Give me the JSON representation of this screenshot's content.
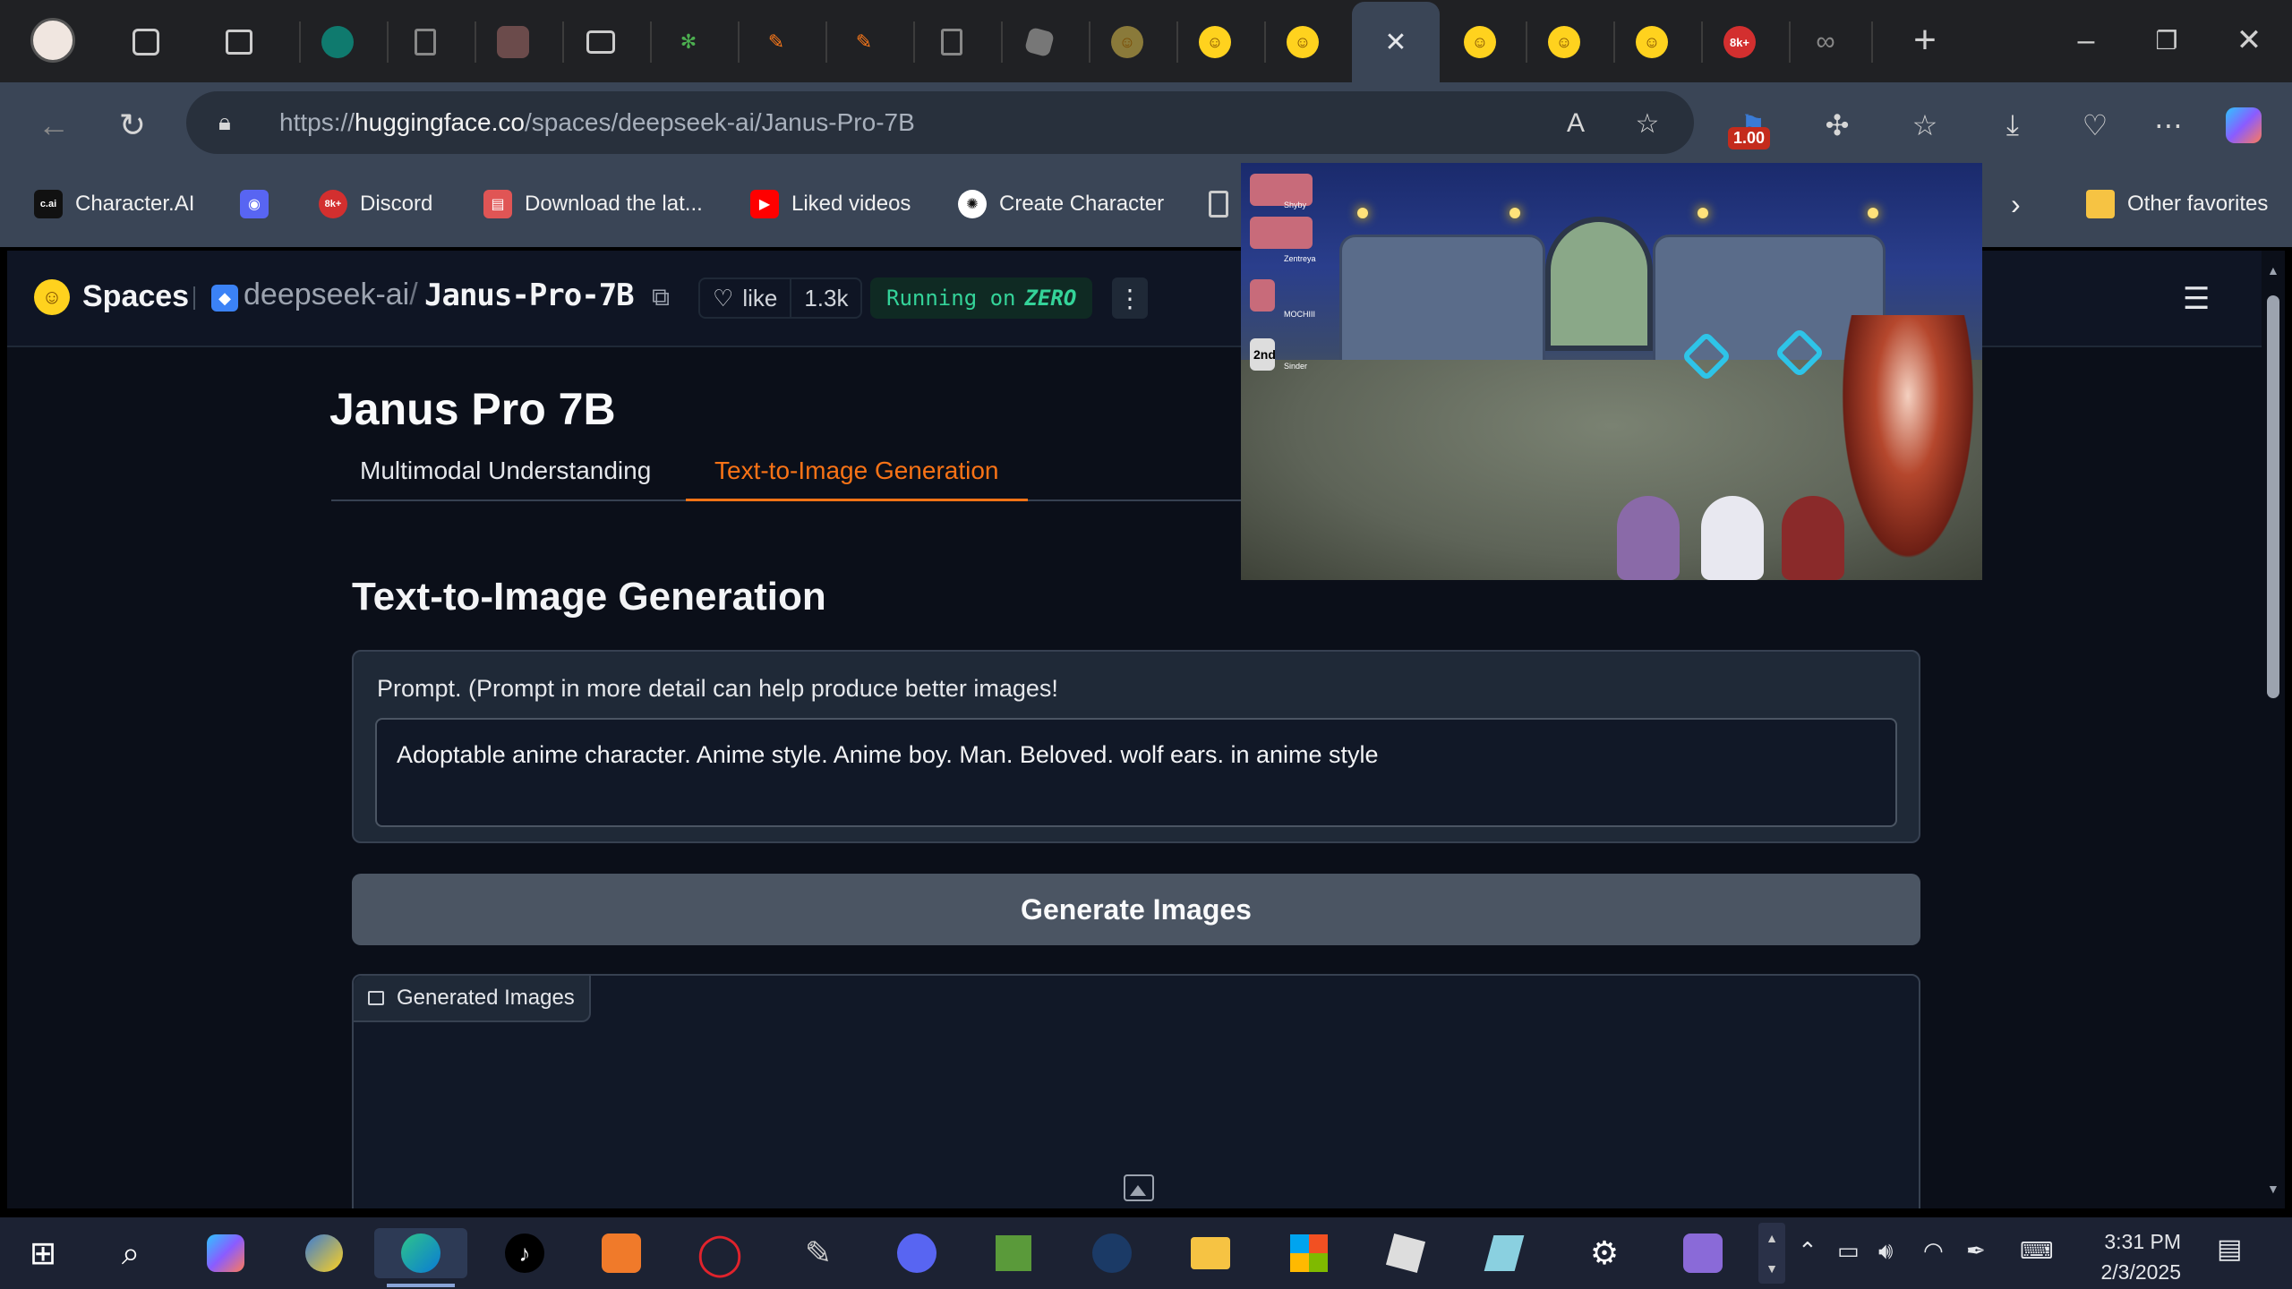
{
  "browser": {
    "url_prefix": "https://",
    "url_host": "huggingface.co",
    "url_path": "/spaces/deepseek-ai/Janus-Pro-7B",
    "active_tab_close": "✕",
    "new_tab": "+",
    "extension_badge": "1.00"
  },
  "favorites": {
    "items": [
      {
        "label": "Character.AI",
        "icon": "c.ai"
      },
      {
        "label": "",
        "icon": "discord-icon"
      },
      {
        "label": "Discord",
        "icon": "8k+"
      },
      {
        "label": "Download the lat...",
        "icon": "store-icon"
      },
      {
        "label": "Liked videos",
        "icon": "youtube-icon"
      },
      {
        "label": "Create Character",
        "icon": "chatgpt-icon"
      }
    ],
    "other": "Other favorites"
  },
  "hf": {
    "spaces": "Spaces",
    "org": "deepseek-ai",
    "slash": "/",
    "repo": "Janus-Pro-7B",
    "like": "like",
    "likes_count": "1.3k",
    "running": "Running on",
    "running_hw": "ZERO"
  },
  "app": {
    "title": "Janus Pro 7B",
    "tabs": [
      {
        "label": "Multimodal Understanding",
        "selected": false
      },
      {
        "label": "Text-to-Image Generation",
        "selected": true
      }
    ],
    "section_title": "Text-to-Image Generation",
    "prompt_label": "Prompt. (Prompt in more detail can help produce better images!",
    "prompt_value": "Adoptable anime character. Anime style. Anime boy. Man. Beloved. wolf ears. in anime style",
    "generate_button": "Generate Images",
    "output_label": "Generated Images"
  },
  "overlay": {
    "leaderboard": [
      "Shyby",
      "Zentreya",
      "MOCHIII",
      "Sinder"
    ],
    "rank_label": "2nd"
  },
  "taskbar": {
    "time": "3:31 PM",
    "date": "2/3/2025"
  }
}
